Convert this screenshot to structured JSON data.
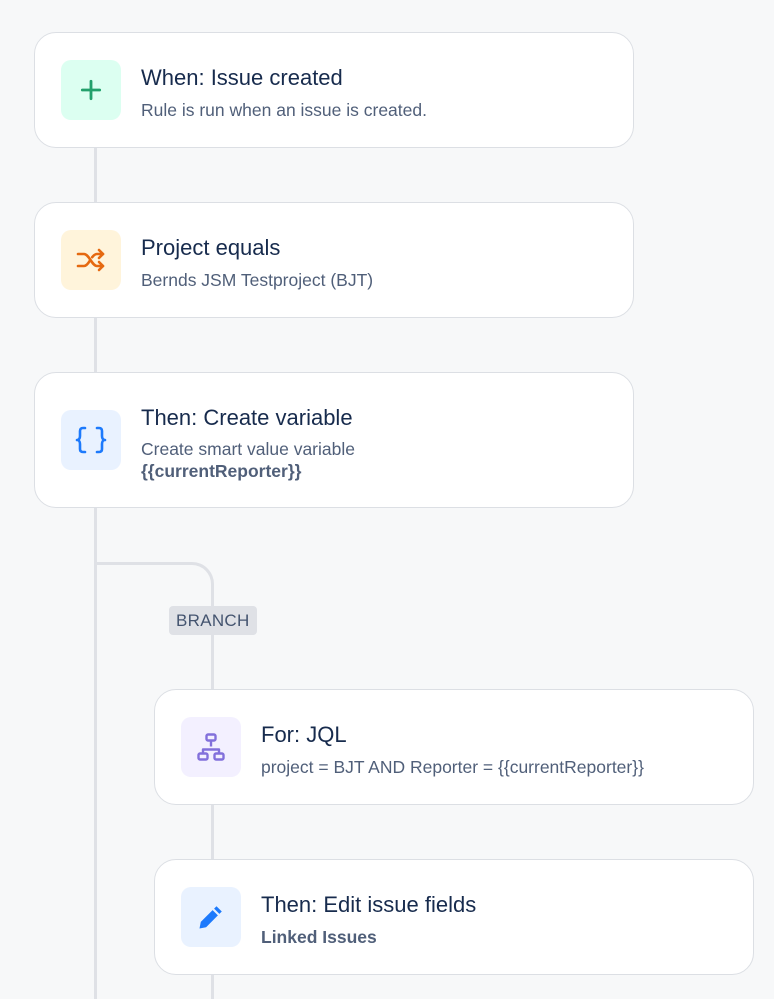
{
  "rule": {
    "trigger": {
      "title": "When: Issue created",
      "subtitle": "Rule is run when an issue is created.",
      "icon": "plus-icon",
      "icon_color": "#22a06b",
      "icon_bg": "#dcfff1"
    },
    "condition": {
      "title": "Project equals",
      "subtitle": "Bernds JSM Testproject (BJT)",
      "icon": "shuffle-icon",
      "icon_color": "#e56910",
      "icon_bg": "#fff4db"
    },
    "action_variable": {
      "title": "Then: Create variable",
      "subtitle": "Create smart value variable",
      "subtitle_bold": "{{currentReporter}}",
      "icon": "curly-braces-icon",
      "icon_color": "#1d7afc",
      "icon_bg": "#e9f2ff"
    },
    "branch": {
      "label": "BRANCH",
      "for_jql": {
        "title": "For: JQL",
        "subtitle": "project = BJT AND Reporter = {{currentReporter}}",
        "icon": "hierarchy-icon",
        "icon_color": "#8270db",
        "icon_bg": "#f3f0ff"
      },
      "edit_fields": {
        "title": "Then: Edit issue fields",
        "subtitle_bold": "Linked Issues",
        "icon": "pencil-icon",
        "icon_color": "#1d7afc",
        "icon_bg": "#e9f2ff"
      }
    }
  }
}
